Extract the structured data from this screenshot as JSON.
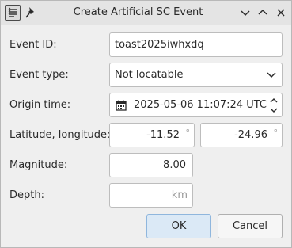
{
  "window": {
    "title": "Create Artificial SC Event"
  },
  "icons": {
    "app": "list-document-icon",
    "pin": "pin-icon",
    "minimize": "chevron-down-icon",
    "maximize": "chevron-up-icon",
    "close": "close-icon",
    "calendar": "calendar-icon"
  },
  "form": {
    "event_id": {
      "label": "Event ID:",
      "value": "toast2025iwhxdq"
    },
    "event_type": {
      "label": "Event type:",
      "value": "Not locatable"
    },
    "origin_time": {
      "label": "Origin time:",
      "value": "2025-05-06 11:07:24 UTC"
    },
    "lat_lon": {
      "label": "Latitude, longitude:",
      "latitude": "-11.52",
      "longitude": "-24.96",
      "unit": "°"
    },
    "magnitude": {
      "label": "Magnitude:",
      "value": "8.00"
    },
    "depth": {
      "label": "Depth:",
      "value": "",
      "unit": "km"
    }
  },
  "buttons": {
    "ok": "OK",
    "cancel": "Cancel"
  },
  "colors": {
    "accent": "#8fb6dd",
    "ok_fill": "#dbe9f6"
  }
}
